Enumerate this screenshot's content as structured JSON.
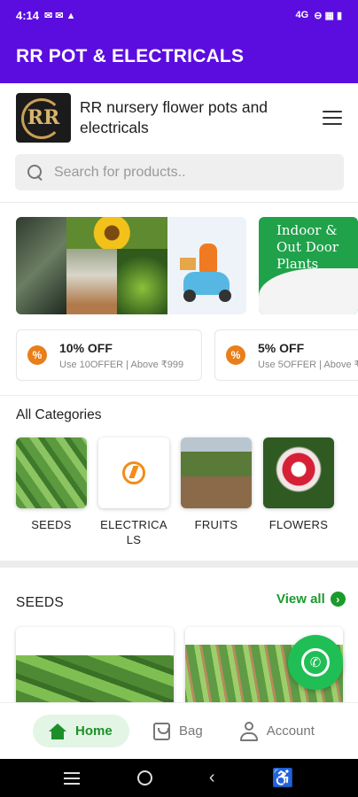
{
  "status_bar": {
    "time": "4:14",
    "left_icons": "✉ ✉ ▲",
    "network": "4G",
    "right_icons": "⊖ ▦ ▮"
  },
  "app_bar": {
    "title": "RR POT & ELECTRICALS"
  },
  "store": {
    "logo_text": "RR",
    "name": "RR nursery flower pots and electricals"
  },
  "search": {
    "placeholder": "Search for products.."
  },
  "banners": [
    {
      "label": "Indoor & Out Door Plants"
    }
  ],
  "coupons": [
    {
      "badge": "%",
      "title": "10% OFF",
      "subtitle": "Use 10OFFER | Above ₹999"
    },
    {
      "badge": "%",
      "title": "5% OFF",
      "subtitle": "Use 5OFFER | Above ₹"
    }
  ],
  "categories": {
    "title": "All Categories",
    "items": [
      {
        "label": "SEEDS"
      },
      {
        "label": "ELECTRICALS"
      },
      {
        "label": "FRUITS"
      },
      {
        "label": "FLOWERS"
      }
    ]
  },
  "section": {
    "title": "SEEDS",
    "view_all": "View all",
    "arrow": "›"
  },
  "whatsapp": {
    "glyph": "✆"
  },
  "bottom_nav": {
    "home": "Home",
    "bag": "Bag",
    "account": "Account"
  },
  "colors": {
    "brand": "#5b0de0",
    "accent": "#1d9a2c",
    "coupon_badge": "#e87f1b",
    "whatsapp": "#1fbf55"
  }
}
